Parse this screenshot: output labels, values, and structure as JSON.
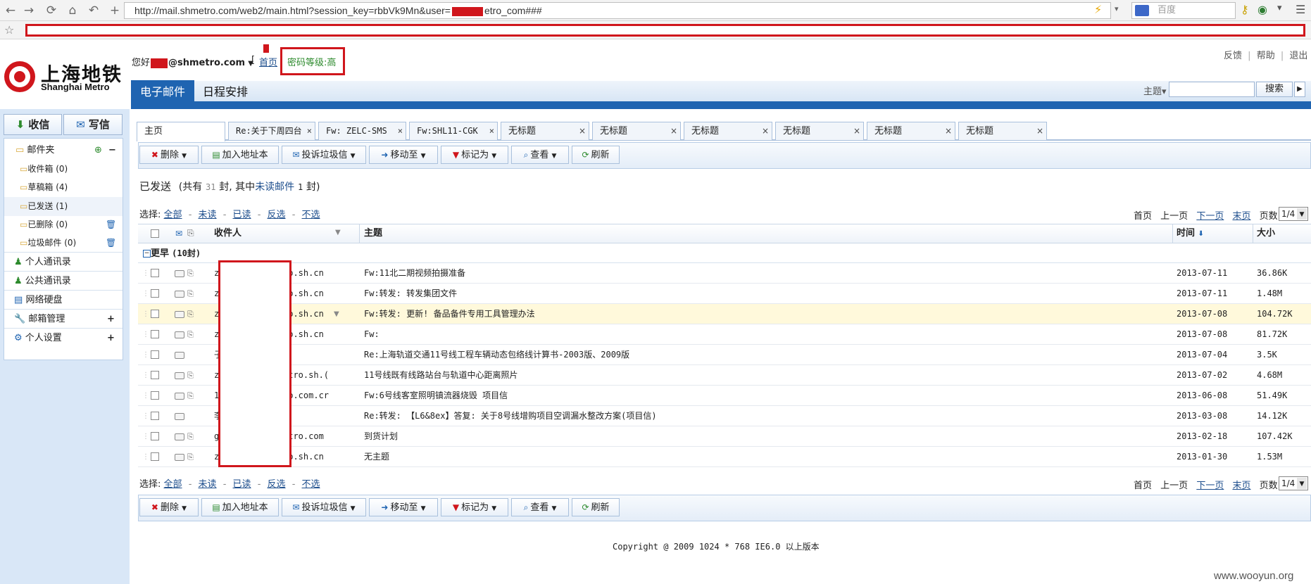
{
  "browser": {
    "url": "http://mail.shmetro.com/web2/main.html?session_key=rbbVk9Mn&user=",
    "url_tail": "etro_com###",
    "search_placeholder": "百度"
  },
  "header": {
    "logo_cn": "上海地铁",
    "logo_en": "Shanghai Metro",
    "greeting": "您好",
    "email_domain": "@shmetro.com",
    "home_link": "首页",
    "password_level": "密码等级:高",
    "top_links": [
      "反馈",
      "帮助",
      "退出"
    ],
    "tabs": [
      "电子邮件",
      "日程安排"
    ],
    "search_label": "主题▾",
    "search_button": "搜索"
  },
  "sidebar": {
    "receive_button": "收信",
    "compose_button": "写信",
    "folders_title": "邮件夹",
    "folders": [
      {
        "label": "收件箱",
        "count": "(0)"
      },
      {
        "label": "草稿箱",
        "count": "(4)"
      },
      {
        "label": "已发送",
        "count": "(1)"
      },
      {
        "label": "已删除",
        "count": "(0)"
      },
      {
        "label": "垃圾邮件",
        "count": "(0)"
      }
    ],
    "items": [
      "个人通讯录",
      "公共通讯录",
      "网络硬盘",
      "邮箱管理",
      "个人设置"
    ]
  },
  "tabs": [
    {
      "label": "主页",
      "closable": false
    },
    {
      "label": "Re:关于下周四台",
      "closable": true
    },
    {
      "label": "Fw: ZELC-SMS",
      "closable": true
    },
    {
      "label": "Fw:SHL11-CGK",
      "closable": true
    },
    {
      "label": "无标题",
      "closable": true
    },
    {
      "label": "无标题",
      "closable": true
    },
    {
      "label": "无标题",
      "closable": true
    },
    {
      "label": "无标题",
      "closable": true
    },
    {
      "label": "无标题",
      "closable": true
    },
    {
      "label": "无标题",
      "closable": true
    }
  ],
  "toolbar": {
    "delete": "删除",
    "add_contact": "加入地址本",
    "report_spam": "投诉垃圾信",
    "move_to": "移动至",
    "mark_as": "标记为",
    "view": "查看",
    "refresh": "刷新"
  },
  "folder": {
    "name": "已发送",
    "summary_pre": "(共有",
    "total": "31",
    "summary_mid": "封, 其中",
    "unread_label": "未读邮件",
    "unread": "1",
    "summary_post": "封)"
  },
  "select": {
    "label": "选择:",
    "options": [
      "全部",
      "未读",
      "已读",
      "反选",
      "不选"
    ]
  },
  "pager": {
    "first": "首页",
    "prev": "上一页",
    "next": "下一页",
    "last": "末页",
    "pages_label": "页数:",
    "page": "1/4"
  },
  "table": {
    "columns": {
      "recipient": "收件人",
      "subject": "主题",
      "time": "时间",
      "size": "大小"
    },
    "group_label": "更早",
    "group_count": "(10封)",
    "rows": [
      {
        "recipient": "z",
        "recipient_tail": "o.sh.cn",
        "subject": "Fw:11北二期视频拍摄准备",
        "time": "2013-07-11",
        "size": "36.86K",
        "attach": true
      },
      {
        "recipient": "z",
        "recipient_tail": "o.sh.cn",
        "subject": "Fw:转发: 转发集团文件",
        "time": "2013-07-11",
        "size": "1.48M",
        "attach": true
      },
      {
        "recipient": "z",
        "recipient_tail": "o.sh.cn",
        "subject": "Fw:转发: 更新! 备品备件专用工具管理办法",
        "time": "2013-07-08",
        "size": "104.72K",
        "attach": true
      },
      {
        "recipient": "z",
        "recipient_tail": "o.sh.cn",
        "subject": "Fw:",
        "time": "2013-07-08",
        "size": "81.72K",
        "attach": true
      },
      {
        "recipient": "子",
        "recipient_tail": "",
        "subject": "Re:上海轨道交通11号线工程车辆动态包络线计算书-2003版、2009版",
        "time": "2013-07-04",
        "size": "3.5K",
        "attach": false
      },
      {
        "recipient": "z",
        "recipient_tail": "tro.sh.(",
        "subject": "11号线既有线路站台与轨道中心距离照片",
        "time": "2013-07-02",
        "size": "4.68M",
        "attach": true
      },
      {
        "recipient": "1",
        "recipient_tail": "o.com.cr",
        "subject": "Fw:6号线客室照明镇流器烧毁 项目信",
        "time": "2013-06-08",
        "size": "51.49K",
        "attach": true
      },
      {
        "recipient": "李",
        "recipient_tail": "",
        "subject": "Re:转发: 【L6&8ex】答复: 关于8号线增购项目空调漏水整改方案(项目信)",
        "time": "2013-03-08",
        "size": "14.12K",
        "attach": false
      },
      {
        "recipient": "g",
        "recipient_tail": "tro.com",
        "subject": "到货计划",
        "time": "2013-02-18",
        "size": "107.42K",
        "attach": true
      },
      {
        "recipient": "z",
        "recipient_tail": "o.sh.cn",
        "subject": "无主题",
        "time": "2013-01-30",
        "size": "1.53M",
        "attach": true
      }
    ]
  },
  "footer": {
    "copyright": "Copyright @ 2009 1024 * 768 IE6.0 以上版本",
    "watermark": "www.wooyun.org"
  },
  "colors": {
    "accent": "#1f64b1",
    "redaction": "#d0161c",
    "highlight_row": "#fff9db",
    "password_green": "#2e8b2e"
  }
}
